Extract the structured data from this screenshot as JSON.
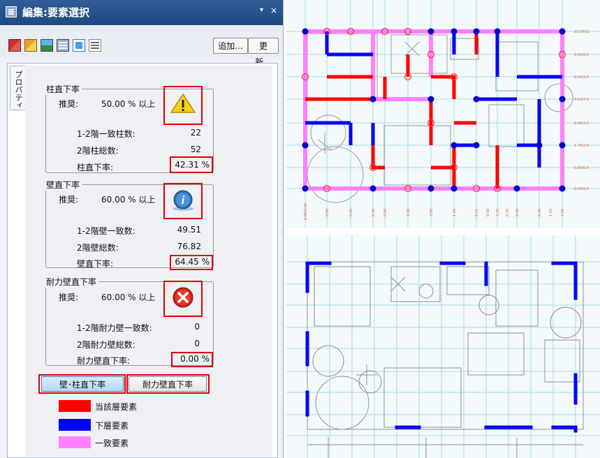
{
  "window": {
    "title": "編集:要素選択",
    "pin": "▾",
    "close": "×"
  },
  "toolbar": {
    "add_label": "追加...",
    "update_label": "更新..."
  },
  "side_tab": {
    "label": "プロパティ"
  },
  "column_ratio": {
    "title": "柱直下率",
    "recommend_label": "推奨:",
    "recommend_value": "50.00 % 以上",
    "status": "warning-icon",
    "rows": [
      {
        "label": "1-2階一致柱数:",
        "value": "22"
      },
      {
        "label": "2階柱総数:",
        "value": "52"
      }
    ],
    "result_label": "柱直下率:",
    "result_value": "42.31 %"
  },
  "wall_ratio": {
    "title": "壁直下率",
    "recommend_label": "推奨:",
    "recommend_value": "60.00 % 以上",
    "status": "info-icon",
    "rows": [
      {
        "label": "1-2階壁一致数:",
        "value": "49.51"
      },
      {
        "label": "2階壁総数:",
        "value": "76.82"
      }
    ],
    "result_label": "壁直下率:",
    "result_value": "64.45 %"
  },
  "shear_ratio": {
    "title": "耐力壁直下率",
    "recommend_label": "推奨:",
    "recommend_value": "60.00 % 以上",
    "status": "error-icon",
    "rows": [
      {
        "label": "1-2階耐力壁一致数:",
        "value": "0"
      },
      {
        "label": "2階耐力壁総数:",
        "value": "0"
      }
    ],
    "result_label": "耐力壁直下率:",
    "result_value": "0.00 %"
  },
  "buttons": {
    "wall_column": "壁･柱直下率",
    "shear_wall": "耐力壁直下率"
  },
  "legend": [
    {
      "label": "当該層要素",
      "color": "#ff0000"
    },
    {
      "label": "下層要素",
      "color": "#0000ff"
    },
    {
      "label": "一致要素",
      "color": "#ff80ff"
    }
  ],
  "plan_top": {
    "right_labels": [
      "15.50/11",
      "0.00/0.0",
      "0.50/2.3",
      "0.53/7.9",
      "0.00/2.3",
      "1.75/2.9",
      "0.00/0.0",
      "0.50/0.0"
    ],
    "bottom_labels": [
      "0.00/0.00",
      "0.00",
      "0.00",
      "0.00",
      "0.00",
      "0.00",
      "3.00",
      "1.00",
      "5.51",
      "0.00",
      "3.25",
      "0.00",
      "0.00",
      "0.00",
      "1.00",
      "7.00"
    ]
  }
}
